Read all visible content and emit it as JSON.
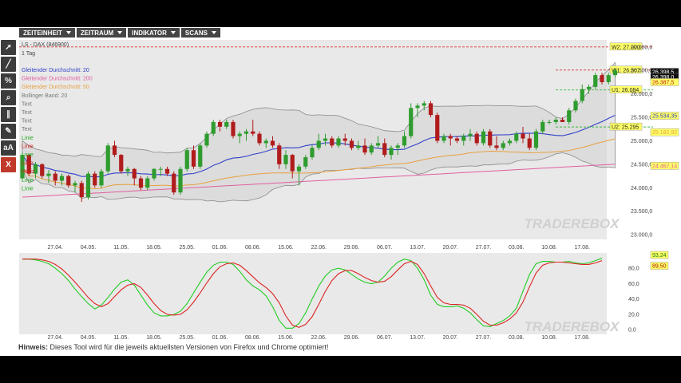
{
  "menu": [
    {
      "label": "ZEITEINHEIT",
      "icon": "chevron-down-icon"
    },
    {
      "label": "ZEITRAUM",
      "icon": "chevron-down-icon"
    },
    {
      "label": "INDIKATOR",
      "icon": "chevron-down-icon"
    },
    {
      "label": "SCANS",
      "icon": "chevron-down-icon"
    }
  ],
  "toolbar": [
    {
      "name": "cursor-tool",
      "icon": "cursor-icon",
      "glyph": "➚"
    },
    {
      "name": "line-tool",
      "icon": "line-icon",
      "glyph": "╱"
    },
    {
      "name": "percent-tool",
      "icon": "percent-icon",
      "glyph": "%"
    },
    {
      "name": "zoom-tool",
      "icon": "magnifier-icon",
      "glyph": "⌕"
    },
    {
      "name": "parallel-lines-tool",
      "icon": "parallel-lines-icon",
      "glyph": "∥"
    },
    {
      "name": "draw-tool",
      "icon": "pencil-icon",
      "glyph": "✎"
    },
    {
      "name": "text-size-tool",
      "icon": "text-icon",
      "glyph": "aA"
    },
    {
      "name": "delete-tool",
      "icon": "close-icon",
      "glyph": "X"
    }
  ],
  "hint": {
    "label": "Hinweis:",
    "text": " Dieses Tool wird für die jeweils aktuellsten Versionen von Firefox und Chrome optimiert!"
  },
  "watermark": "TRADEREBOX",
  "colors": {
    "up": "#2e9c2e",
    "down": "#b01c1c",
    "sma20": "#3040c8",
    "sma200": "#e060a0",
    "sma50": "#e8a040",
    "band": "#d2d2d2",
    "resistance": "#e03030",
    "price_tag": "#111111"
  },
  "chart_data": [
    {
      "type": "candlestick",
      "title": "LS - DAX (846900)",
      "subtitle": "1 Tag",
      "legend": [
        {
          "label": "Gleitender Durchschnitt: 20",
          "color": "#3040c8"
        },
        {
          "label": "Gleitender Durchschnitt: 200",
          "color": "#e060a0"
        },
        {
          "label": "Gleitender Durchschnitt: 50",
          "color": "#e8a040"
        },
        {
          "label": "Bollinger Band: 20",
          "color": "#777777"
        },
        {
          "label": "Text",
          "color": "#777777"
        },
        {
          "label": "Text",
          "color": "#777777"
        },
        {
          "label": "Text",
          "color": "#777777"
        },
        {
          "label": "Text",
          "color": "#777777"
        },
        {
          "label": "Linie",
          "color": "#22aa22"
        },
        {
          "label": "Linie",
          "color": "#cc2222"
        },
        {
          "label": "Linie",
          "color": "#22aa22"
        },
        {
          "label": "Linie",
          "color": "#cc2222"
        },
        {
          "label": "Horiz",
          "color": "#cc2222"
        },
        {
          "label": "Linie",
          "color": "#22aa22"
        },
        {
          "label": "Linie",
          "color": "#22aa22"
        }
      ],
      "x_ticks": [
        "27.04.",
        "04.05.",
        "11.05.",
        "18.05.",
        "25.05.",
        "01.06.",
        "08.06.",
        "15.06.",
        "22.06.",
        "29.06.",
        "06.07.",
        "13.07.",
        "20.07.",
        "27.07.",
        "03.08.",
        "10.08.",
        "17.08."
      ],
      "x_tick_index": [
        5,
        10,
        15,
        20,
        25,
        30,
        35,
        40,
        45,
        50,
        55,
        60,
        65,
        70,
        75,
        80,
        85
      ],
      "y_ticks": [
        "27.000,0",
        "26.500,0",
        "26.000,0",
        "25.500,0",
        "25.000,0",
        "24.500,0",
        "24.000,0",
        "23.500,0",
        "23.000,0"
      ],
      "ylim": [
        22900,
        27150
      ],
      "candles": [
        [
          24200,
          24750,
          24150,
          24700
        ],
        [
          24700,
          24720,
          24250,
          24300
        ],
        [
          24300,
          24550,
          24200,
          24500
        ],
        [
          24500,
          24520,
          24200,
          24250
        ],
        [
          24250,
          24380,
          24100,
          24300
        ],
        [
          24300,
          24350,
          24050,
          24150
        ],
        [
          24150,
          24300,
          24050,
          24250
        ],
        [
          24250,
          24280,
          24000,
          24050
        ],
        [
          24050,
          24150,
          23900,
          24100
        ],
        [
          24100,
          24150,
          23700,
          23800
        ],
        [
          23800,
          24350,
          23750,
          24300
        ],
        [
          24300,
          24350,
          24000,
          24050
        ],
        [
          24050,
          24400,
          24000,
          24350
        ],
        [
          24350,
          24950,
          24300,
          24900
        ],
        [
          24900,
          25000,
          24650,
          24700
        ],
        [
          24700,
          24720,
          24300,
          24350
        ],
        [
          24350,
          24450,
          24250,
          24400
        ],
        [
          24400,
          24420,
          24050,
          24200
        ],
        [
          24200,
          24250,
          23950,
          24000
        ],
        [
          24000,
          24250,
          23950,
          24200
        ],
        [
          24200,
          24420,
          24150,
          24400
        ],
        [
          24400,
          24450,
          24250,
          24400
        ],
        [
          24400,
          24450,
          24250,
          24300
        ],
        [
          24300,
          24350,
          23850,
          23900
        ],
        [
          23900,
          24450,
          23850,
          24400
        ],
        [
          24400,
          24850,
          24350,
          24800
        ],
        [
          24800,
          24900,
          24400,
          24450
        ],
        [
          24450,
          24950,
          24400,
          24900
        ],
        [
          24900,
          25200,
          24850,
          25150
        ],
        [
          25150,
          25450,
          25100,
          25400
        ],
        [
          25400,
          25450,
          25200,
          25300
        ],
        [
          25300,
          25450,
          25250,
          25400
        ],
        [
          25400,
          25450,
          25050,
          25100
        ],
        [
          25100,
          25200,
          24950,
          25150
        ],
        [
          25150,
          25250,
          25000,
          25200
        ],
        [
          25200,
          25450,
          25100,
          25150
        ],
        [
          25150,
          25200,
          24900,
          24950
        ],
        [
          24950,
          25050,
          24850,
          25000
        ],
        [
          25000,
          25100,
          24850,
          24900
        ],
        [
          24900,
          24950,
          24400,
          24500
        ],
        [
          24500,
          24800,
          24400,
          24700
        ],
        [
          24700,
          24720,
          24200,
          24350
        ],
        [
          24350,
          24500,
          24050,
          24450
        ],
        [
          24450,
          24700,
          24400,
          24650
        ],
        [
          24650,
          24900,
          24600,
          24850
        ],
        [
          24850,
          25150,
          24800,
          25000
        ],
        [
          25000,
          25150,
          24900,
          25050
        ],
        [
          25050,
          25100,
          24850,
          24900
        ],
        [
          24900,
          25100,
          24850,
          25050
        ],
        [
          25050,
          25150,
          24900,
          25000
        ],
        [
          25000,
          25050,
          24800,
          24850
        ],
        [
          24850,
          25000,
          24800,
          24900
        ],
        [
          24900,
          25050,
          24700,
          24750
        ],
        [
          24750,
          24950,
          24700,
          24900
        ],
        [
          24900,
          25100,
          24850,
          24950
        ],
        [
          24950,
          25050,
          24650,
          24700
        ],
        [
          24700,
          24900,
          24600,
          24850
        ],
        [
          24850,
          24950,
          24700,
          24900
        ],
        [
          24900,
          25200,
          24850,
          25100
        ],
        [
          25100,
          25800,
          25050,
          25700
        ],
        [
          25700,
          25800,
          25500,
          25750
        ],
        [
          25750,
          25850,
          25650,
          25800
        ],
        [
          25800,
          25850,
          25500,
          25550
        ],
        [
          25550,
          25600,
          24950,
          25000
        ],
        [
          25000,
          25150,
          24950,
          25100
        ],
        [
          25100,
          25150,
          24900,
          25050
        ],
        [
          25050,
          25100,
          24950,
          25000
        ],
        [
          25000,
          25150,
          24900,
          25100
        ],
        [
          25100,
          25250,
          25000,
          25150
        ],
        [
          25150,
          25200,
          24900,
          24950
        ],
        [
          24950,
          25250,
          24900,
          25200
        ],
        [
          25200,
          25250,
          24850,
          24900
        ],
        [
          24900,
          25100,
          24800,
          24850
        ],
        [
          24850,
          25000,
          24800,
          24950
        ],
        [
          24950,
          25050,
          24900,
          25000
        ],
        [
          25000,
          25200,
          24950,
          25150
        ],
        [
          25150,
          25300,
          24950,
          25050
        ],
        [
          25050,
          25150,
          24800,
          24850
        ],
        [
          24850,
          25250,
          24800,
          25200
        ],
        [
          25200,
          25450,
          25150,
          25400
        ],
        [
          25400,
          25450,
          25350,
          25400
        ],
        [
          25400,
          25500,
          25350,
          25450
        ],
        [
          25450,
          25500,
          25400,
          25400
        ],
        [
          25400,
          25700,
          25350,
          25650
        ],
        [
          25650,
          25900,
          25600,
          25850
        ],
        [
          25850,
          26200,
          25800,
          26100
        ],
        [
          26100,
          26200,
          26000,
          26150
        ],
        [
          26150,
          26450,
          26100,
          26400
        ],
        [
          26400,
          26450,
          26200,
          26250
        ],
        [
          26250,
          26450,
          26200,
          26400
        ],
        [
          26400,
          26550,
          26350,
          26500
        ]
      ],
      "hlines": [
        {
          "label": "W2: 27.000",
          "value": 27000,
          "color": "#e03030"
        },
        {
          "label": "W1: 26.507",
          "value": 26507,
          "color": "#e03030"
        },
        {
          "label": "U1: 26.084",
          "value": 26084,
          "color": "#3cb83c"
        },
        {
          "label": "U2: 25.295",
          "value": 25295,
          "color": "#3cb83c"
        }
      ],
      "price_labels": [
        {
          "label": "26.398,5",
          "value": 26470,
          "color": "#111111"
        },
        {
          "label": "26.398,0",
          "value": 26360,
          "color": "#111111"
        },
        {
          "label": "26.387,5",
          "value": 26250,
          "color": "#c02020"
        },
        {
          "label": "25.534,35",
          "value": 25534,
          "color": "#3040c8"
        },
        {
          "label": "25.182,92",
          "value": 25183,
          "color": "#e8a040"
        },
        {
          "label": "24.467,14",
          "value": 24467,
          "color": "#e060a0"
        }
      ]
    },
    {
      "type": "line",
      "title": "",
      "y_ticks": [
        "80,0",
        "60,0",
        "40,0",
        "20,0",
        "0,0"
      ],
      "y_tick_values": [
        80,
        60,
        40,
        20,
        0
      ],
      "ylim": [
        -6,
        100
      ],
      "x_ticks": [
        "27.04.",
        "04.05.",
        "11.05.",
        "18.05.",
        "25.05.",
        "01.06.",
        "08.06.",
        "15.06.",
        "22.06.",
        "29.06.",
        "06.07.",
        "13.07.",
        "20.07.",
        "27.07.",
        "03.08.",
        "10.08.",
        "17.08."
      ],
      "series": [
        {
          "color": "#22cc22",
          "values": [
            92,
            92,
            91,
            89,
            86,
            80,
            73,
            64,
            53,
            43,
            34,
            27,
            32,
            42,
            53,
            62,
            65,
            58,
            45,
            32,
            22,
            18,
            18,
            20,
            24,
            34,
            48,
            62,
            75,
            84,
            88,
            88,
            85,
            76,
            65,
            57,
            52,
            44,
            30,
            12,
            2,
            2,
            8,
            22,
            40,
            57,
            70,
            78,
            80,
            78,
            72,
            66,
            62,
            60,
            62,
            70,
            80,
            88,
            92,
            90,
            80,
            65,
            45,
            33,
            30,
            30,
            31,
            28,
            22,
            13,
            5,
            4,
            8,
            12,
            18,
            28,
            50,
            72,
            86,
            89,
            89,
            88,
            88,
            89,
            87,
            86,
            87,
            90,
            93
          ]
        },
        {
          "color": "#dd2222",
          "values": [
            92,
            92,
            92,
            91,
            89,
            85,
            79,
            71,
            62,
            52,
            42,
            34,
            30,
            34,
            43,
            52,
            58,
            60,
            55,
            45,
            34,
            25,
            20,
            19,
            20,
            26,
            36,
            48,
            61,
            73,
            82,
            86,
            87,
            84,
            77,
            69,
            61,
            55,
            47,
            35,
            18,
            6,
            3,
            7,
            17,
            33,
            50,
            64,
            73,
            77,
            77,
            73,
            68,
            64,
            62,
            63,
            69,
            78,
            86,
            89,
            85,
            73,
            57,
            42,
            35,
            33,
            33,
            32,
            28,
            20,
            11,
            6,
            6,
            9,
            14,
            22,
            36,
            56,
            74,
            84,
            87,
            88,
            88,
            87,
            86,
            85,
            85,
            87,
            90
          ]
        }
      ],
      "value_labels": [
        {
          "label": "93,24",
          "value": 93.24,
          "color": "#22cc22"
        },
        {
          "label": "89,50",
          "value": 89.5,
          "color": "#dd2222"
        }
      ]
    }
  ]
}
